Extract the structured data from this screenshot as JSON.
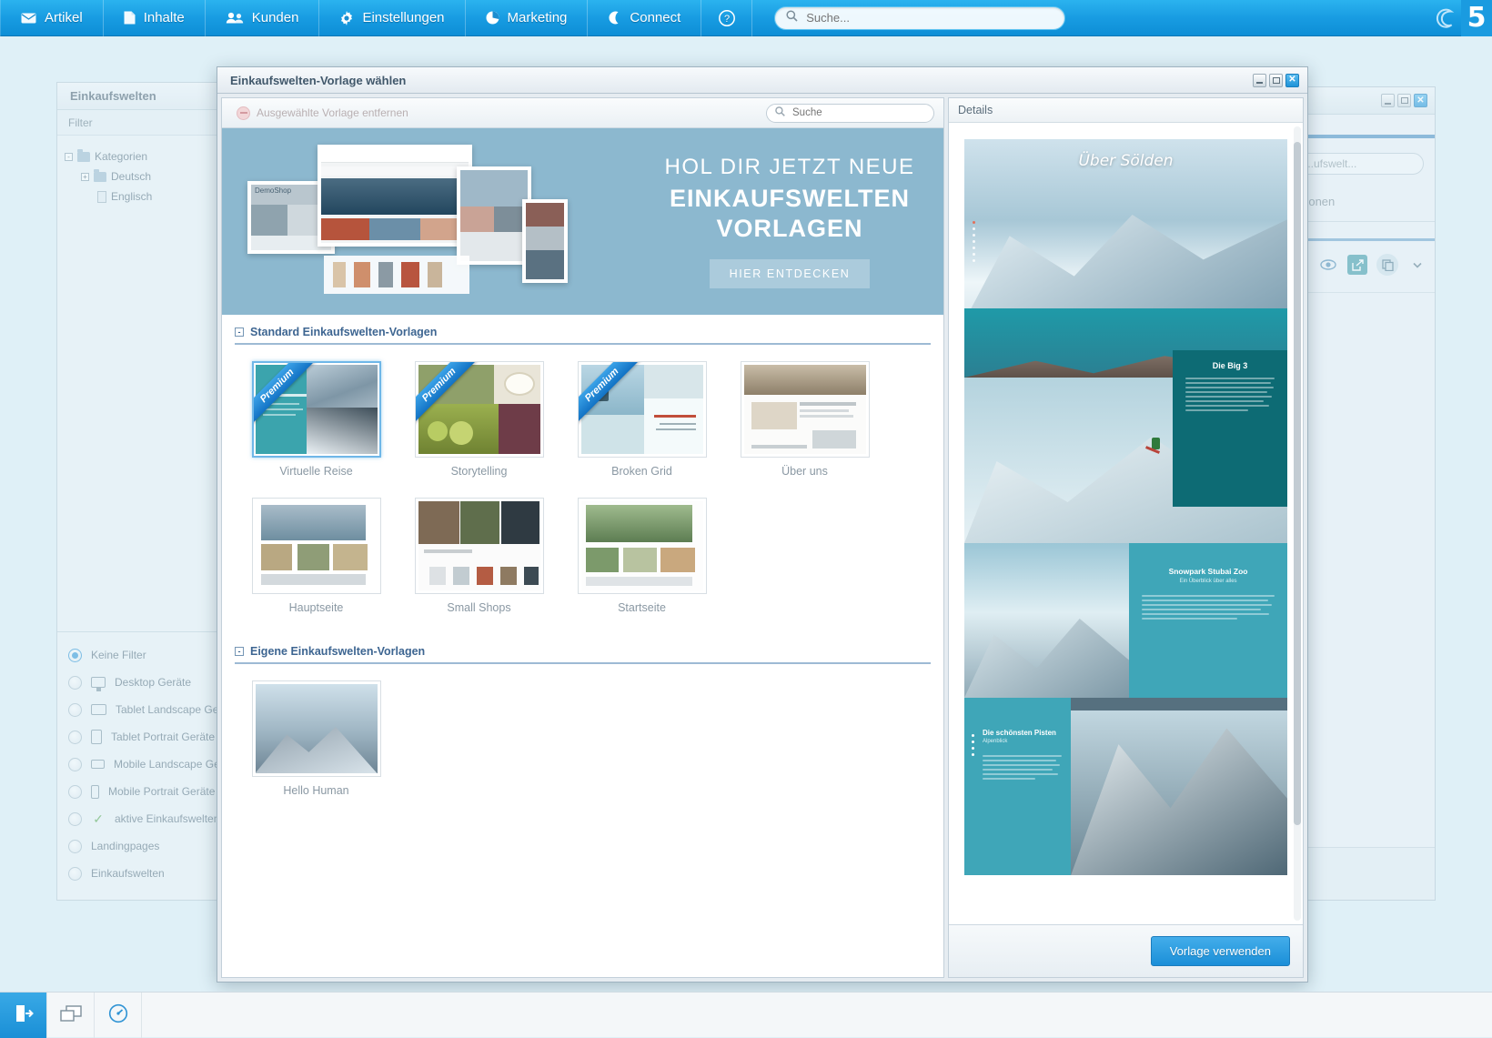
{
  "topnav": {
    "items": [
      {
        "label": "Artikel",
        "icon": "mail-icon"
      },
      {
        "label": "Inhalte",
        "icon": "document-icon"
      },
      {
        "label": "Kunden",
        "icon": "users-icon"
      },
      {
        "label": "Einstellungen",
        "icon": "gear-icon"
      },
      {
        "label": "Marketing",
        "icon": "pie-chart-icon"
      },
      {
        "label": "Connect",
        "icon": "moon-icon"
      }
    ],
    "help_icon": "help-icon",
    "search": {
      "placeholder": "Suche...",
      "value": "",
      "icon": "search-icon"
    },
    "brand_icon": "shopware-swirl-icon",
    "brand_version": "5"
  },
  "background_left": {
    "title": "Einkaufswelten",
    "filter_label": "Filter",
    "tree": [
      {
        "label": "Kategorien",
        "level": 1,
        "toggle": "-",
        "icon": "folder-open-icon"
      },
      {
        "label": "Deutsch",
        "level": 2,
        "toggle": "+",
        "icon": "folder-icon"
      },
      {
        "label": "Englisch",
        "level": 3,
        "toggle": "",
        "icon": "document-icon"
      }
    ],
    "filters": [
      {
        "label": "Keine Filter",
        "selected": true,
        "icon": ""
      },
      {
        "label": "Desktop Geräte",
        "selected": false,
        "icon": "desktop-icon"
      },
      {
        "label": "Tablet Landscape Geräte",
        "selected": false,
        "icon": "tablet-landscape-icon"
      },
      {
        "label": "Tablet Portrait Geräte",
        "selected": false,
        "icon": "tablet-portrait-icon"
      },
      {
        "label": "Mobile Landscape Geräte",
        "selected": false,
        "icon": "mobile-landscape-icon"
      },
      {
        "label": "Mobile Portrait Geräte",
        "selected": false,
        "icon": "mobile-portrait-icon"
      },
      {
        "label": "aktive Einkaufswelten",
        "selected": false,
        "icon": "check-icon"
      },
      {
        "label": "Landingpages",
        "selected": false,
        "icon": ""
      },
      {
        "label": "Einkaufswelten",
        "selected": false,
        "icon": ""
      }
    ]
  },
  "background_right": {
    "search_placeholder": "...ufswelt...",
    "section_label": "...tionen",
    "tools": [
      "edit-pencil-icon",
      "eye-preview-icon",
      "export-icon",
      "duplicate-icon",
      "chevron-down-icon"
    ],
    "window_buttons": [
      "minimize",
      "maximize",
      "close"
    ]
  },
  "modal": {
    "title": "Einkaufswelten-Vorlage wählen",
    "window_buttons": [
      "minimize",
      "maximize",
      "close"
    ],
    "toolbar": {
      "remove_label": "Ausgewählte Vorlage entfernen",
      "remove_icon": "minus-circle-icon",
      "search": {
        "placeholder": "Suche",
        "value": "",
        "icon": "search-icon"
      }
    },
    "banner": {
      "line1": "HOL DIR JETZT NEUE",
      "line2": "EINKAUFSWELTEN",
      "line3": "VORLAGEN",
      "button": "HIER ENTDECKEN",
      "shop_label": "DemoShop"
    },
    "sections": [
      {
        "title": "Standard Einkaufswelten-Vorlagen",
        "collapse": "-",
        "templates": [
          {
            "label": "Virtuelle Reise",
            "premium": true,
            "premium_label": "Premium",
            "selected": true
          },
          {
            "label": "Storytelling",
            "premium": true,
            "premium_label": "Premium",
            "selected": false
          },
          {
            "label": "Broken Grid",
            "premium": true,
            "premium_label": "Premium",
            "selected": false
          },
          {
            "label": "Über uns",
            "premium": false,
            "premium_label": "",
            "selected": false
          },
          {
            "label": "Hauptseite",
            "premium": false,
            "premium_label": "",
            "selected": false
          },
          {
            "label": "Small Shops",
            "premium": false,
            "premium_label": "",
            "selected": false
          },
          {
            "label": "Startseite",
            "premium": false,
            "premium_label": "",
            "selected": false
          }
        ]
      },
      {
        "title": "Eigene Einkaufswelten-Vorlagen",
        "collapse": "-",
        "templates": [
          {
            "label": "Hello Human",
            "premium": false,
            "premium_label": "",
            "selected": false
          }
        ]
      }
    ],
    "details": {
      "header": "Details",
      "preview_title": "Über Sölden",
      "cards": [
        {
          "title": "Die Big 3"
        },
        {
          "title": "Snowpark Stubai Zoo",
          "subtitle": "Ein Überblick über alles"
        },
        {
          "title": "Die schönsten Pisten",
          "subtitle": "Alpenblick"
        }
      ],
      "use_button": "Vorlage verwenden"
    }
  },
  "taskbar": {
    "buttons": [
      {
        "icon": "logout-icon",
        "active": true
      },
      {
        "icon": "windows-icon",
        "active": false
      },
      {
        "icon": "performance-icon",
        "active": false
      }
    ]
  }
}
